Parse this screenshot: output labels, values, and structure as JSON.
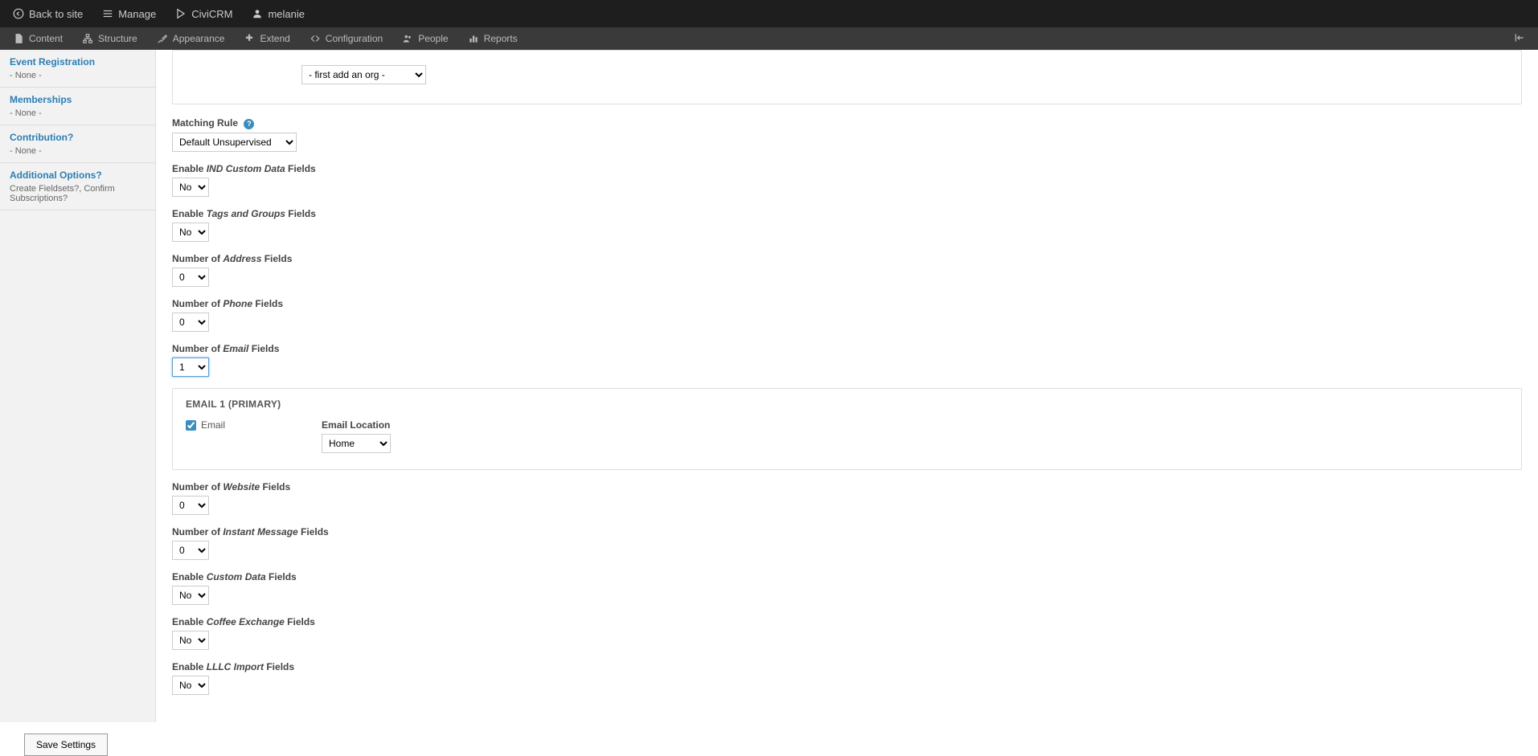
{
  "topbar": {
    "back": "Back to site",
    "manage": "Manage",
    "civicrm": "CiviCRM",
    "user": "melanie"
  },
  "menubar": {
    "content": "Content",
    "structure": "Structure",
    "appearance": "Appearance",
    "extend": "Extend",
    "configuration": "Configuration",
    "people": "People",
    "reports": "Reports"
  },
  "sidebar": {
    "eventreg": {
      "title": "Event Registration",
      "sub": "- None -"
    },
    "memberships": {
      "title": "Memberships",
      "sub": "- None -"
    },
    "contribution": {
      "title": "Contribution?",
      "sub": "- None -"
    },
    "additional": {
      "title": "Additional Options?",
      "sub": "Create Fieldsets?, Confirm Subscriptions?"
    }
  },
  "form": {
    "orgselect": "- first add an org -",
    "matching": {
      "label": "Matching Rule",
      "value": "Default Unsupervised"
    },
    "ind": {
      "prefix": "Enable ",
      "italic": "IND Custom Data",
      "suffix": " Fields",
      "value": "No"
    },
    "tags": {
      "prefix": "Enable ",
      "italic": "Tags and Groups",
      "suffix": " Fields",
      "value": "No"
    },
    "address": {
      "prefix": "Number of ",
      "italic": "Address",
      "suffix": " Fields",
      "value": "0"
    },
    "phone": {
      "prefix": "Number of ",
      "italic": "Phone",
      "suffix": " Fields",
      "value": "0"
    },
    "email": {
      "prefix": "Number of ",
      "italic": "Email",
      "suffix": " Fields",
      "value": "1"
    },
    "emailfieldset": {
      "title": "EMAIL 1 (PRIMARY)",
      "checkbox": "Email",
      "loclabel": "Email Location",
      "locvalue": "Home"
    },
    "website": {
      "prefix": "Number of ",
      "italic": "Website",
      "suffix": " Fields",
      "value": "0"
    },
    "im": {
      "prefix": "Number of ",
      "italic": "Instant Message",
      "suffix": " Fields",
      "value": "0"
    },
    "custom": {
      "prefix": "Enable ",
      "italic": "Custom Data",
      "suffix": " Fields",
      "value": "No"
    },
    "coffee": {
      "prefix": "Enable ",
      "italic": "Coffee Exchange",
      "suffix": " Fields",
      "value": "No"
    },
    "lllc": {
      "prefix": "Enable ",
      "italic": "LLLC Import",
      "suffix": " Fields",
      "value": "No"
    }
  },
  "save": "Save Settings"
}
